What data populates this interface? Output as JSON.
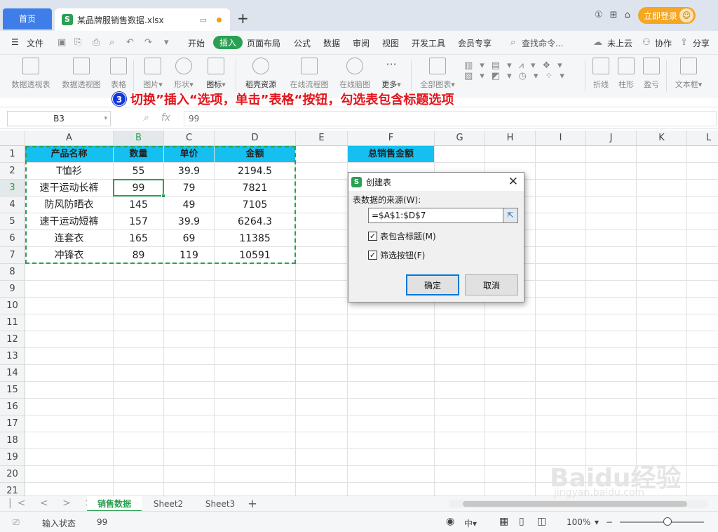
{
  "titlebar": {
    "home_tab": "首页",
    "file_tab": "某品牌服销售数据.xlsx",
    "new_tab": "+",
    "window_icons": [
      "1⃣",
      "⊞",
      "⌂"
    ],
    "login": "立即登录"
  },
  "menu": {
    "file": "文件",
    "items": [
      "开始",
      "插入",
      "页面布局",
      "公式",
      "数据",
      "审阅",
      "视图",
      "开发工具",
      "会员专享"
    ],
    "active": "插入",
    "search": "查找命令...",
    "cloud": "未上云",
    "collab": "协作",
    "share": "分享"
  },
  "ribbon": {
    "buttons": [
      "数据透视表",
      "数据透视图",
      "表格",
      "图片",
      "形状",
      "图标",
      "稻壳资源",
      "在线流程图",
      "在线脑图",
      "更多",
      "全部图表",
      "折线",
      "柱形",
      "盈亏",
      "文本框"
    ]
  },
  "annotation": {
    "step": "3",
    "text": "切换”插入“选项，单击”表格“按钮，勾选表包含标题选项"
  },
  "formula": {
    "cell_ref": "B3",
    "fx": "fx",
    "value": "99"
  },
  "grid": {
    "columns": [
      "A",
      "B",
      "C",
      "D",
      "E",
      "F",
      "G",
      "H",
      "I",
      "J",
      "K",
      "L"
    ],
    "selected_col": "B",
    "selected_row": "3",
    "rows": [
      "1",
      "2",
      "3",
      "4",
      "5",
      "6",
      "7",
      "8",
      "9",
      "10",
      "11",
      "12",
      "13",
      "14",
      "15",
      "16",
      "17",
      "18",
      "19",
      "20",
      "21"
    ],
    "headers": [
      "产品名称",
      "数量",
      "单价",
      "金额"
    ],
    "data": [
      [
        "T恤衫",
        "55",
        "39.9",
        "2194.5"
      ],
      [
        "速干运动长裤",
        "99",
        "79",
        "7821"
      ],
      [
        "防风防晒衣",
        "145",
        "49",
        "7105"
      ],
      [
        "速干运动短裤",
        "157",
        "39.9",
        "6264.3"
      ],
      [
        "连套衣",
        "165",
        "69",
        "11385"
      ],
      [
        "冲锋衣",
        "89",
        "119",
        "10591"
      ]
    ],
    "f1": "总销售金额"
  },
  "dialog": {
    "title": "创建表",
    "source_label": "表数据的来源(W):",
    "source_value": "=$A$1:$D$7",
    "has_headers": "表包含标题(M)",
    "filter_btn": "筛选按钮(F)",
    "ok": "确定",
    "cancel": "取消"
  },
  "sheets": {
    "tabs": [
      "销售数据",
      "Sheet2",
      "Sheet3"
    ],
    "add": "+"
  },
  "status": {
    "mode": "输入状态",
    "value": "99",
    "zoom": "100%"
  },
  "watermark": {
    "brand": "Baidu经验",
    "url": "jingyan.baidu.com"
  }
}
